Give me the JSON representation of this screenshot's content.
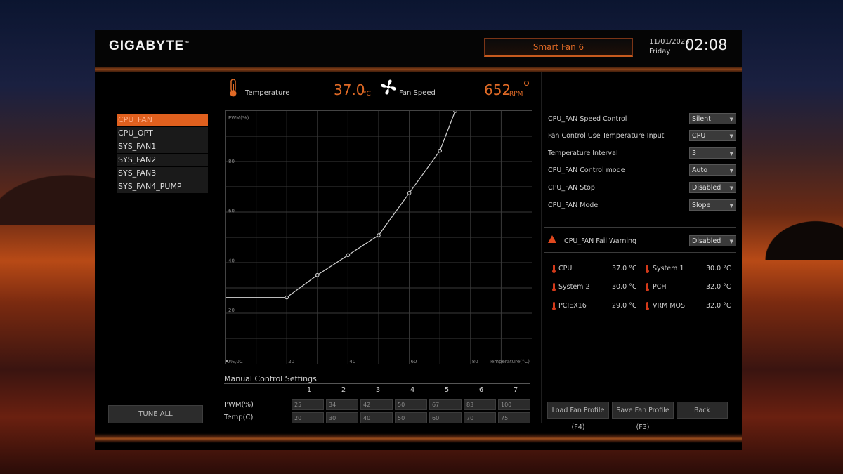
{
  "header": {
    "logo": "GIGABYTE",
    "page_tab": "Smart Fan 6",
    "date": "11/01/2023",
    "day": "Friday",
    "time": "02:08"
  },
  "readouts": {
    "temperature_label": "Temperature",
    "temperature_value": "37.0",
    "temperature_unit": "°C",
    "fan_speed_label": "Fan Speed",
    "fan_speed_value": "652",
    "fan_speed_unit": "RPM"
  },
  "fan_list": [
    {
      "label": "CPU_FAN",
      "active": true
    },
    {
      "label": "CPU_OPT",
      "active": false
    },
    {
      "label": "SYS_FAN1",
      "active": false
    },
    {
      "label": "SYS_FAN2",
      "active": false
    },
    {
      "label": "SYS_FAN3",
      "active": false
    },
    {
      "label": "SYS_FAN4_PUMP",
      "active": false
    }
  ],
  "tune_all_label": "TUNE ALL",
  "chart_data": {
    "type": "line",
    "ylabel": "PWM(%)",
    "xlabel": "Temperature(°C)",
    "xlim": [
      0,
      100
    ],
    "ylim": [
      0,
      100
    ],
    "x_ticks": [
      "0%,0C",
      "20",
      "40",
      "60",
      "80"
    ],
    "y_ticks": [
      "20",
      "40",
      "60",
      "80"
    ],
    "grid": true,
    "x": [
      20,
      30,
      40,
      50,
      60,
      70,
      75
    ],
    "y": [
      25,
      34,
      42,
      50,
      67,
      84,
      100
    ]
  },
  "manual": {
    "title": "Manual Control Settings",
    "columns": [
      "1",
      "2",
      "3",
      "4",
      "5",
      "6",
      "7"
    ],
    "pwm_label": "PWM(%)",
    "temp_label": "Temp(C)",
    "pwm": [
      "25",
      "34",
      "42",
      "50",
      "67",
      "83",
      "100"
    ],
    "temp": [
      "20",
      "30",
      "40",
      "50",
      "60",
      "70",
      "75"
    ]
  },
  "settings": [
    {
      "label": "CPU_FAN Speed Control",
      "value": "Silent"
    },
    {
      "label": "Fan Control Use Temperature Input",
      "value": "CPU"
    },
    {
      "label": "Temperature Interval",
      "value": "3"
    },
    {
      "label": "CPU_FAN Control mode",
      "value": "Auto"
    },
    {
      "label": "CPU_FAN Stop",
      "value": "Disabled"
    },
    {
      "label": "CPU_FAN Mode",
      "value": "Slope"
    }
  ],
  "fail_warning": {
    "label": "CPU_FAN Fail Warning",
    "value": "Disabled"
  },
  "temps": [
    {
      "label": "CPU",
      "value": "37.0 °C"
    },
    {
      "label": "System 1",
      "value": "30.0 °C"
    },
    {
      "label": "System 2",
      "value": "30.0 °C"
    },
    {
      "label": "PCH",
      "value": "32.0 °C"
    },
    {
      "label": "PCIEX16",
      "value": "29.0 °C"
    },
    {
      "label": "VRM MOS",
      "value": "32.0 °C"
    }
  ],
  "buttons": {
    "load": "Load Fan Profile (F4)",
    "save": "Save Fan Profile (F3)",
    "back": "Back"
  },
  "colors": {
    "accent": "#e0601e",
    "warning": "#e0481e"
  }
}
